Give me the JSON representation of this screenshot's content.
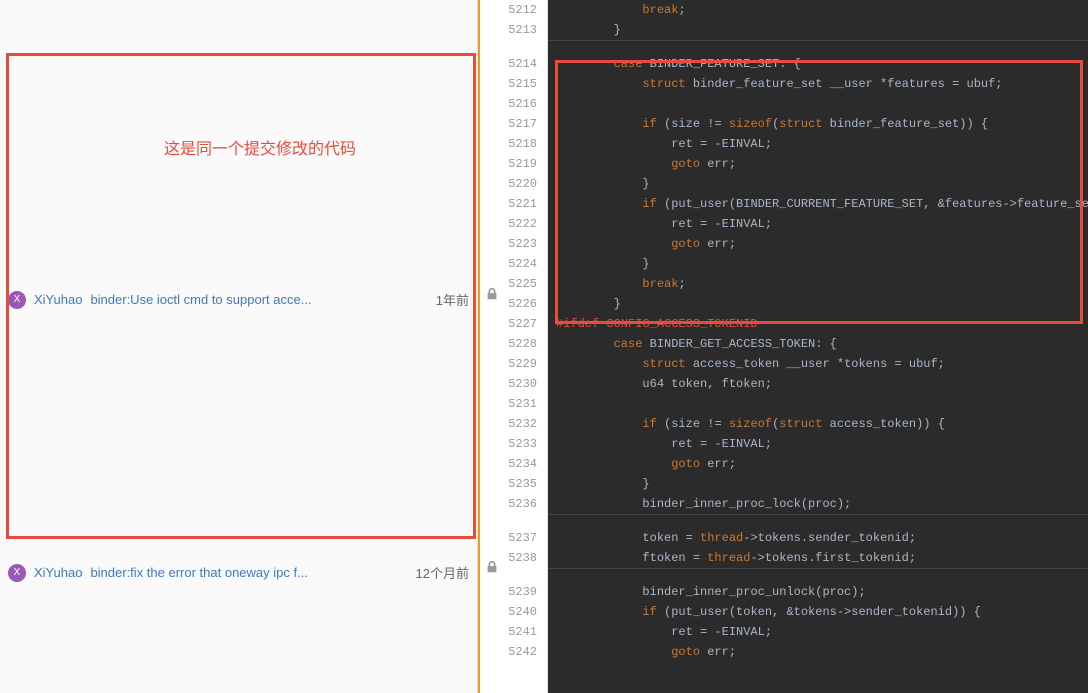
{
  "annotation": {
    "text": "这是同一个提交修改的代码"
  },
  "commits": [
    {
      "avatar_letter": "X",
      "author": "XiYuhao",
      "message": "binder:Use ioctl cmd to support acce...",
      "time": "1年前"
    },
    {
      "avatar_letter": "X",
      "author": "XiYuhao",
      "message": "binder:fix the error that oneway ipc f...",
      "time": "12个月前"
    }
  ],
  "line_numbers": [
    "5212",
    "5213",
    "5214",
    "5215",
    "5216",
    "5217",
    "5218",
    "5219",
    "5220",
    "5221",
    "5222",
    "5223",
    "5224",
    "5225",
    "5226",
    "5227",
    "5228",
    "5229",
    "5230",
    "5231",
    "5232",
    "5233",
    "5234",
    "5235",
    "5236",
    "5237",
    "5238",
    "5239",
    "5240",
    "5241",
    "5242"
  ],
  "code_lines": [
    {
      "indent": "            ",
      "tokens": [
        {
          "t": "break",
          "c": "kw"
        },
        {
          "t": ";",
          "c": "op"
        }
      ]
    },
    {
      "indent": "        }",
      "tokens": []
    },
    {
      "indent": "        ",
      "tokens": [
        {
          "t": "case",
          "c": "kw"
        },
        {
          "t": " BINDER_FEATURE_SET: {",
          "c": "ident"
        }
      ]
    },
    {
      "indent": "            ",
      "tokens": [
        {
          "t": "struct",
          "c": "kw"
        },
        {
          "t": " binder_feature_set __user *features = ubuf;",
          "c": "ident"
        }
      ]
    },
    {
      "indent": "",
      "tokens": []
    },
    {
      "indent": "            ",
      "tokens": [
        {
          "t": "if",
          "c": "kw"
        },
        {
          "t": " (size != ",
          "c": "ident"
        },
        {
          "t": "sizeof",
          "c": "kw"
        },
        {
          "t": "(",
          "c": "ident"
        },
        {
          "t": "struct",
          "c": "kw"
        },
        {
          "t": " binder_feature_set)) {",
          "c": "ident"
        }
      ]
    },
    {
      "indent": "                ",
      "tokens": [
        {
          "t": "ret = -EINVAL;",
          "c": "ident"
        }
      ]
    },
    {
      "indent": "                ",
      "tokens": [
        {
          "t": "goto",
          "c": "kw"
        },
        {
          "t": " err;",
          "c": "ident"
        }
      ]
    },
    {
      "indent": "            }",
      "tokens": []
    },
    {
      "indent": "            ",
      "tokens": [
        {
          "t": "if",
          "c": "kw"
        },
        {
          "t": " (put_user(BINDER_CURRENT_FEATURE_SET, &features->feature_set)) {",
          "c": "ident"
        }
      ]
    },
    {
      "indent": "                ",
      "tokens": [
        {
          "t": "ret = -EINVAL;",
          "c": "ident"
        }
      ]
    },
    {
      "indent": "                ",
      "tokens": [
        {
          "t": "goto",
          "c": "kw"
        },
        {
          "t": " err;",
          "c": "ident"
        }
      ]
    },
    {
      "indent": "            }",
      "tokens": []
    },
    {
      "indent": "            ",
      "tokens": [
        {
          "t": "break",
          "c": "kw"
        },
        {
          "t": ";",
          "c": "op"
        }
      ]
    },
    {
      "indent": "        }",
      "tokens": []
    },
    {
      "indent": "",
      "tokens": [
        {
          "t": "#ifdef CONFIG_ACCESS_TOKENID",
          "c": "macro-red"
        }
      ]
    },
    {
      "indent": "        ",
      "tokens": [
        {
          "t": "case",
          "c": "kw"
        },
        {
          "t": " BINDER_GET_ACCESS_TOKEN: {",
          "c": "ident"
        }
      ]
    },
    {
      "indent": "            ",
      "tokens": [
        {
          "t": "struct",
          "c": "kw"
        },
        {
          "t": " access_token __user *tokens = ubuf;",
          "c": "ident"
        }
      ]
    },
    {
      "indent": "            ",
      "tokens": [
        {
          "t": "u64 token, ftoken;",
          "c": "ident"
        }
      ]
    },
    {
      "indent": "",
      "tokens": []
    },
    {
      "indent": "            ",
      "tokens": [
        {
          "t": "if",
          "c": "kw"
        },
        {
          "t": " (size != ",
          "c": "ident"
        },
        {
          "t": "sizeof",
          "c": "kw"
        },
        {
          "t": "(",
          "c": "ident"
        },
        {
          "t": "struct",
          "c": "kw"
        },
        {
          "t": " access_token)) {",
          "c": "ident"
        }
      ]
    },
    {
      "indent": "                ",
      "tokens": [
        {
          "t": "ret = -EINVAL;",
          "c": "ident"
        }
      ]
    },
    {
      "indent": "                ",
      "tokens": [
        {
          "t": "goto",
          "c": "kw"
        },
        {
          "t": " err;",
          "c": "ident"
        }
      ]
    },
    {
      "indent": "            }",
      "tokens": []
    },
    {
      "indent": "            ",
      "tokens": [
        {
          "t": "binder_inner_proc_lock(proc);",
          "c": "ident"
        }
      ]
    },
    {
      "indent": "            ",
      "tokens": [
        {
          "t": "token = ",
          "c": "ident"
        },
        {
          "t": "thread",
          "c": "kw"
        },
        {
          "t": "->tokens.sender_tokenid;",
          "c": "ident"
        }
      ]
    },
    {
      "indent": "            ",
      "tokens": [
        {
          "t": "ftoken = ",
          "c": "ident"
        },
        {
          "t": "thread",
          "c": "kw"
        },
        {
          "t": "->tokens.first_tokenid;",
          "c": "ident"
        }
      ]
    },
    {
      "indent": "            ",
      "tokens": [
        {
          "t": "binder_inner_proc_unlock(proc);",
          "c": "ident"
        }
      ]
    },
    {
      "indent": "            ",
      "tokens": [
        {
          "t": "if",
          "c": "kw"
        },
        {
          "t": " (put_user(token, &tokens->sender_tokenid)) {",
          "c": "ident"
        }
      ]
    },
    {
      "indent": "                ",
      "tokens": [
        {
          "t": "ret = -EINVAL;",
          "c": "ident"
        }
      ]
    },
    {
      "indent": "                ",
      "tokens": [
        {
          "t": "goto",
          "c": "kw"
        },
        {
          "t": " err;",
          "c": "ident"
        }
      ]
    }
  ],
  "gutter_groups": [
    {
      "start": 0,
      "end": 1,
      "gap_after": true
    },
    {
      "start": 2,
      "end": 14,
      "gap_after": false
    },
    {
      "start": 15,
      "end": 24,
      "gap_after": true
    },
    {
      "start": 25,
      "end": 26,
      "gap_after": true
    },
    {
      "start": 27,
      "end": 30,
      "gap_after": false
    }
  ]
}
